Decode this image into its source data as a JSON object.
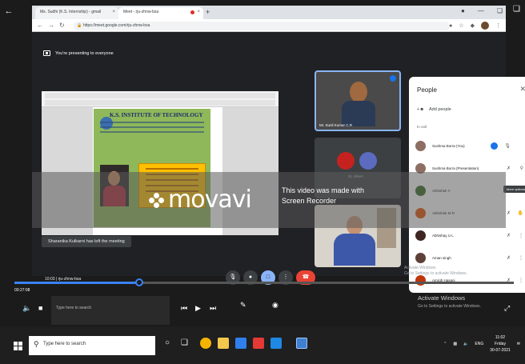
{
  "browser": {
    "tabs": [
      {
        "label": "Ms. Sudhi (K.S. Internship) - gmail",
        "active": false
      },
      {
        "label": "Meet - rju-zhnw-bsa",
        "active": true
      }
    ],
    "url": "https://meet.google.com/rju-zhnw-bsa"
  },
  "meet": {
    "presenting_text": "You're presenting to everyone",
    "poster_title": "K.S. INSTITUTE OF TECHNOLOGY",
    "toast": "Sharanika Kulkarni has left the meeting",
    "tiles": [
      {
        "label": "Mr. Sunil Kumar C.R"
      },
      {
        "label": "51 others"
      },
      {
        "label": ""
      }
    ],
    "meeting_time": "10:03",
    "meeting_code": "rju-zhnw-bsa"
  },
  "people": {
    "title": "People",
    "add_people": "Add people",
    "in_call": "In call",
    "tooltip": "More options",
    "list": [
      {
        "name": "Sushma Borra (You)",
        "color": "#8d6e63"
      },
      {
        "name": "Sushma Borra (Presentation)",
        "color": "#8d6e63"
      },
      {
        "name": "Abhishek V",
        "color": "#33691e"
      },
      {
        "name": "Abhishek M R",
        "color": "#e65100"
      },
      {
        "name": "Abhishay U L",
        "color": "#3e2723"
      },
      {
        "name": "Aman singh",
        "color": "#5d4037"
      },
      {
        "name": "Amrgh Hasani",
        "color": "#bf360c"
      }
    ]
  },
  "watermark": {
    "logo": "movavi",
    "line1": "This video was made with",
    "line2": "Screen Recorder"
  },
  "player": {
    "time_left": "00:27:08",
    "time_right": "01:27:56",
    "progress": 0.25,
    "activate_title": "Activate Windows",
    "activate_sub": "Go to Settings to activate Windows."
  },
  "inner_taskbar": {
    "search_placeholder": "Type here to search"
  },
  "taskbar": {
    "search_placeholder": "Type here to search",
    "tray_lang": "ENG",
    "time": "11:02",
    "day": "Friday",
    "date": "30-07-2021"
  }
}
